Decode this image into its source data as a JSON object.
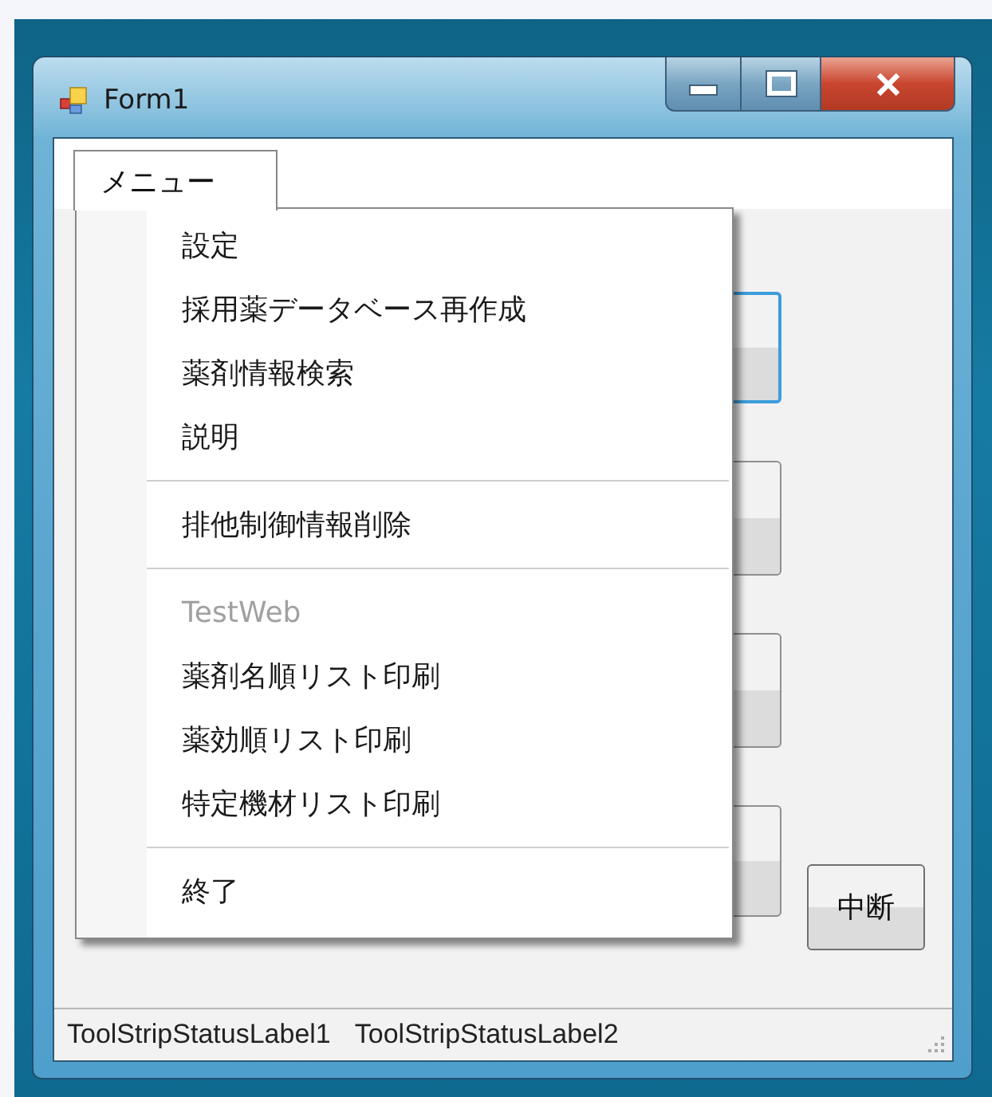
{
  "window": {
    "title": "Form1"
  },
  "menu_bar": [
    {
      "label": "メニュー",
      "expanded": true
    }
  ],
  "menu_items": [
    {
      "kind": "item",
      "label": "設定",
      "disabled": false
    },
    {
      "kind": "item",
      "label": "採用薬データベース再作成",
      "disabled": false
    },
    {
      "kind": "item",
      "label": "薬剤情報検索",
      "disabled": false
    },
    {
      "kind": "item",
      "label": "説明",
      "disabled": false
    },
    {
      "kind": "separator"
    },
    {
      "kind": "item",
      "label": "排他制御情報削除",
      "disabled": false
    },
    {
      "kind": "separator"
    },
    {
      "kind": "item",
      "label": "TestWeb",
      "disabled": true
    },
    {
      "kind": "item",
      "label": "薬剤名順リスト印刷",
      "disabled": false
    },
    {
      "kind": "item",
      "label": "薬効順リスト印刷",
      "disabled": false
    },
    {
      "kind": "item",
      "label": "特定機材リスト印刷",
      "disabled": false
    },
    {
      "kind": "separator"
    },
    {
      "kind": "item",
      "label": "終了",
      "disabled": false
    }
  ],
  "form_buttons": [
    {
      "focused": true
    },
    {
      "focused": false
    },
    {
      "focused": false
    },
    {
      "focused": false
    }
  ],
  "stop_button": {
    "label": "中断"
  },
  "status_bar": [
    "ToolStripStatusLabel1",
    "ToolStripStatusLabel2"
  ]
}
